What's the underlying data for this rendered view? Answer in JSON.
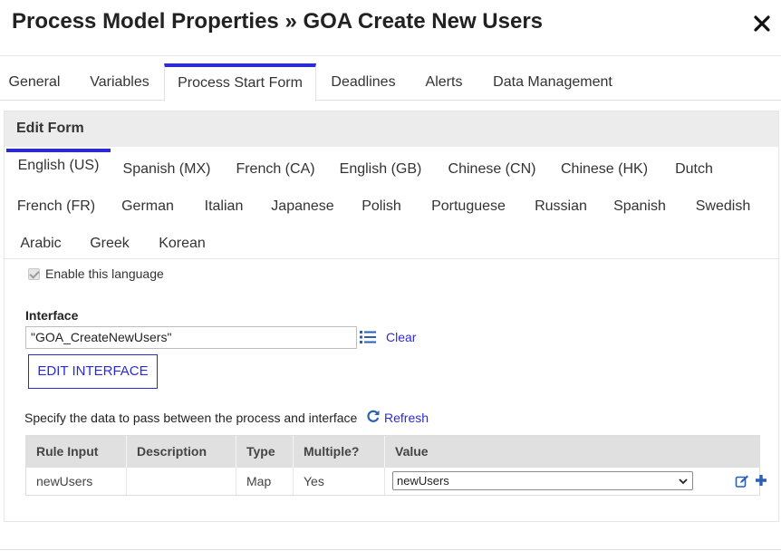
{
  "dialog": {
    "title": "Process Model Properties » GOA Create New Users",
    "close_icon": "close-icon"
  },
  "main_tabs": [
    {
      "label": "General",
      "active": false
    },
    {
      "label": "Variables",
      "active": false
    },
    {
      "label": "Process Start Form",
      "active": true
    },
    {
      "label": "Deadlines",
      "active": false
    },
    {
      "label": "Alerts",
      "active": false
    },
    {
      "label": "Data Management",
      "active": false
    }
  ],
  "panel": {
    "header": "Edit Form",
    "language_tabs": [
      {
        "label": "English (US)",
        "active": true
      },
      {
        "label": "Spanish (MX)"
      },
      {
        "label": "French (CA)"
      },
      {
        "label": "English (GB)"
      },
      {
        "label": "Chinese (CN)"
      },
      {
        "label": "Chinese (HK)"
      },
      {
        "label": "Dutch"
      },
      {
        "label": "French (FR)"
      },
      {
        "label": "German"
      },
      {
        "label": "Italian"
      },
      {
        "label": "Japanese"
      },
      {
        "label": "Polish"
      },
      {
        "label": "Portuguese"
      },
      {
        "label": "Russian"
      },
      {
        "label": "Spanish"
      },
      {
        "label": "Swedish"
      },
      {
        "label": "Arabic"
      },
      {
        "label": "Greek"
      },
      {
        "label": "Korean"
      }
    ],
    "enable_language": {
      "label": "Enable this language",
      "checked": true,
      "disabled": true
    },
    "interface": {
      "label": "Interface",
      "value": "\"GOA_CreateNewUsers\"",
      "list_icon": "list-icon",
      "clear_label": "Clear"
    },
    "edit_interface_label": "EDIT INTERFACE",
    "specify_text": "Specify the data to pass between the process and interface",
    "refresh_label": "Refresh",
    "table": {
      "headers": [
        "Rule Input",
        "Description",
        "Type",
        "Multiple?",
        "Value"
      ],
      "rows": [
        {
          "rule_input": "newUsers",
          "description": "",
          "type": "Map",
          "multiple": "Yes",
          "value": "newUsers"
        }
      ]
    }
  },
  "colors": {
    "accent": "#2b2bd6",
    "header_bg": "#ececec",
    "table_header_bg": "#e0e0e0"
  }
}
